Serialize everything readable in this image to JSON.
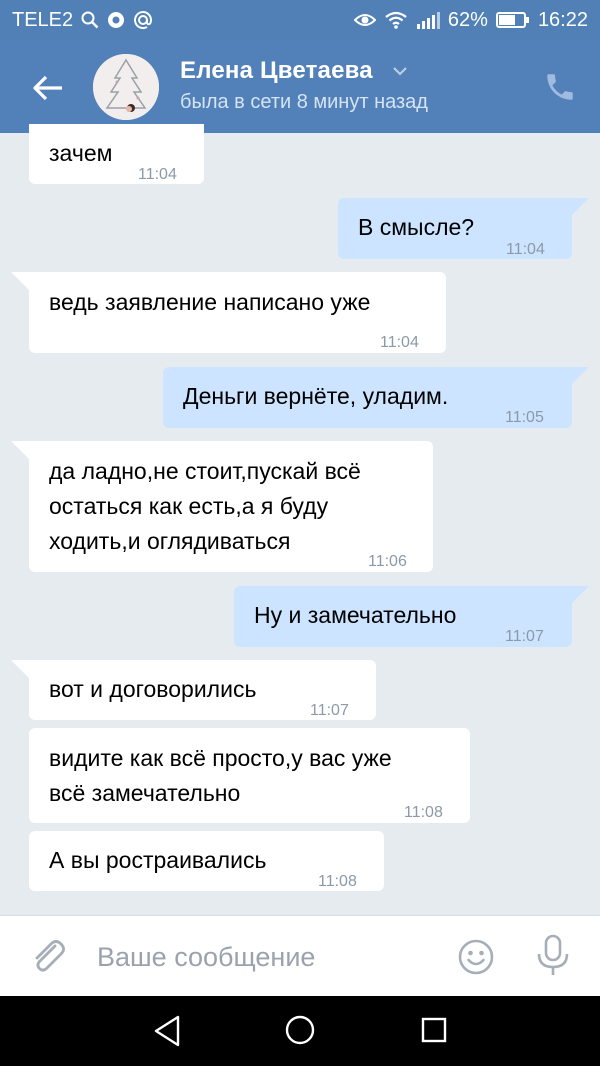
{
  "status_bar": {
    "carrier": "TELE2",
    "battery": "62%",
    "time": "16:22"
  },
  "header": {
    "contact_name": "Елена Цветаева",
    "last_seen": "была в сети 8 минут назад"
  },
  "messages": [
    {
      "direction": "incoming",
      "text": "зачем",
      "time": "11:04"
    },
    {
      "direction": "outgoing",
      "text": "В смысле?",
      "time": "11:04"
    },
    {
      "direction": "incoming",
      "text": "ведь заявление написано уже",
      "time": "11:04"
    },
    {
      "direction": "outgoing",
      "text": "Деньги вернёте, уладим.",
      "time": "11:05"
    },
    {
      "direction": "incoming",
      "lines": [
        "да ладно,не стоит,пускай всё",
        "остаться как есть,а я буду",
        "ходить,и оглядиваться"
      ],
      "time": "11:06"
    },
    {
      "direction": "outgoing",
      "text": "Ну и замечательно",
      "time": "11:07"
    },
    {
      "direction": "incoming",
      "text": "вот и договорились",
      "time": "11:07"
    },
    {
      "direction": "incoming",
      "lines": [
        "видите как всё просто,у вас уже",
        "всё замечательно"
      ],
      "time": "11:08"
    },
    {
      "direction": "incoming",
      "text": "А вы ростраивались",
      "time": "11:08"
    }
  ],
  "composer": {
    "placeholder": "Ваше сообщение"
  },
  "colors": {
    "header_bg": "#5181b8",
    "outgoing_bubble": "#cce4ff",
    "incoming_bubble": "#ffffff",
    "chat_bg": "#e6ebf0"
  },
  "icons": [
    "back-arrow-icon",
    "chevron-down-icon",
    "phone-icon",
    "attach-icon",
    "emoji-icon",
    "mic-icon",
    "nav-back-icon",
    "nav-home-icon",
    "nav-recent-icon"
  ]
}
